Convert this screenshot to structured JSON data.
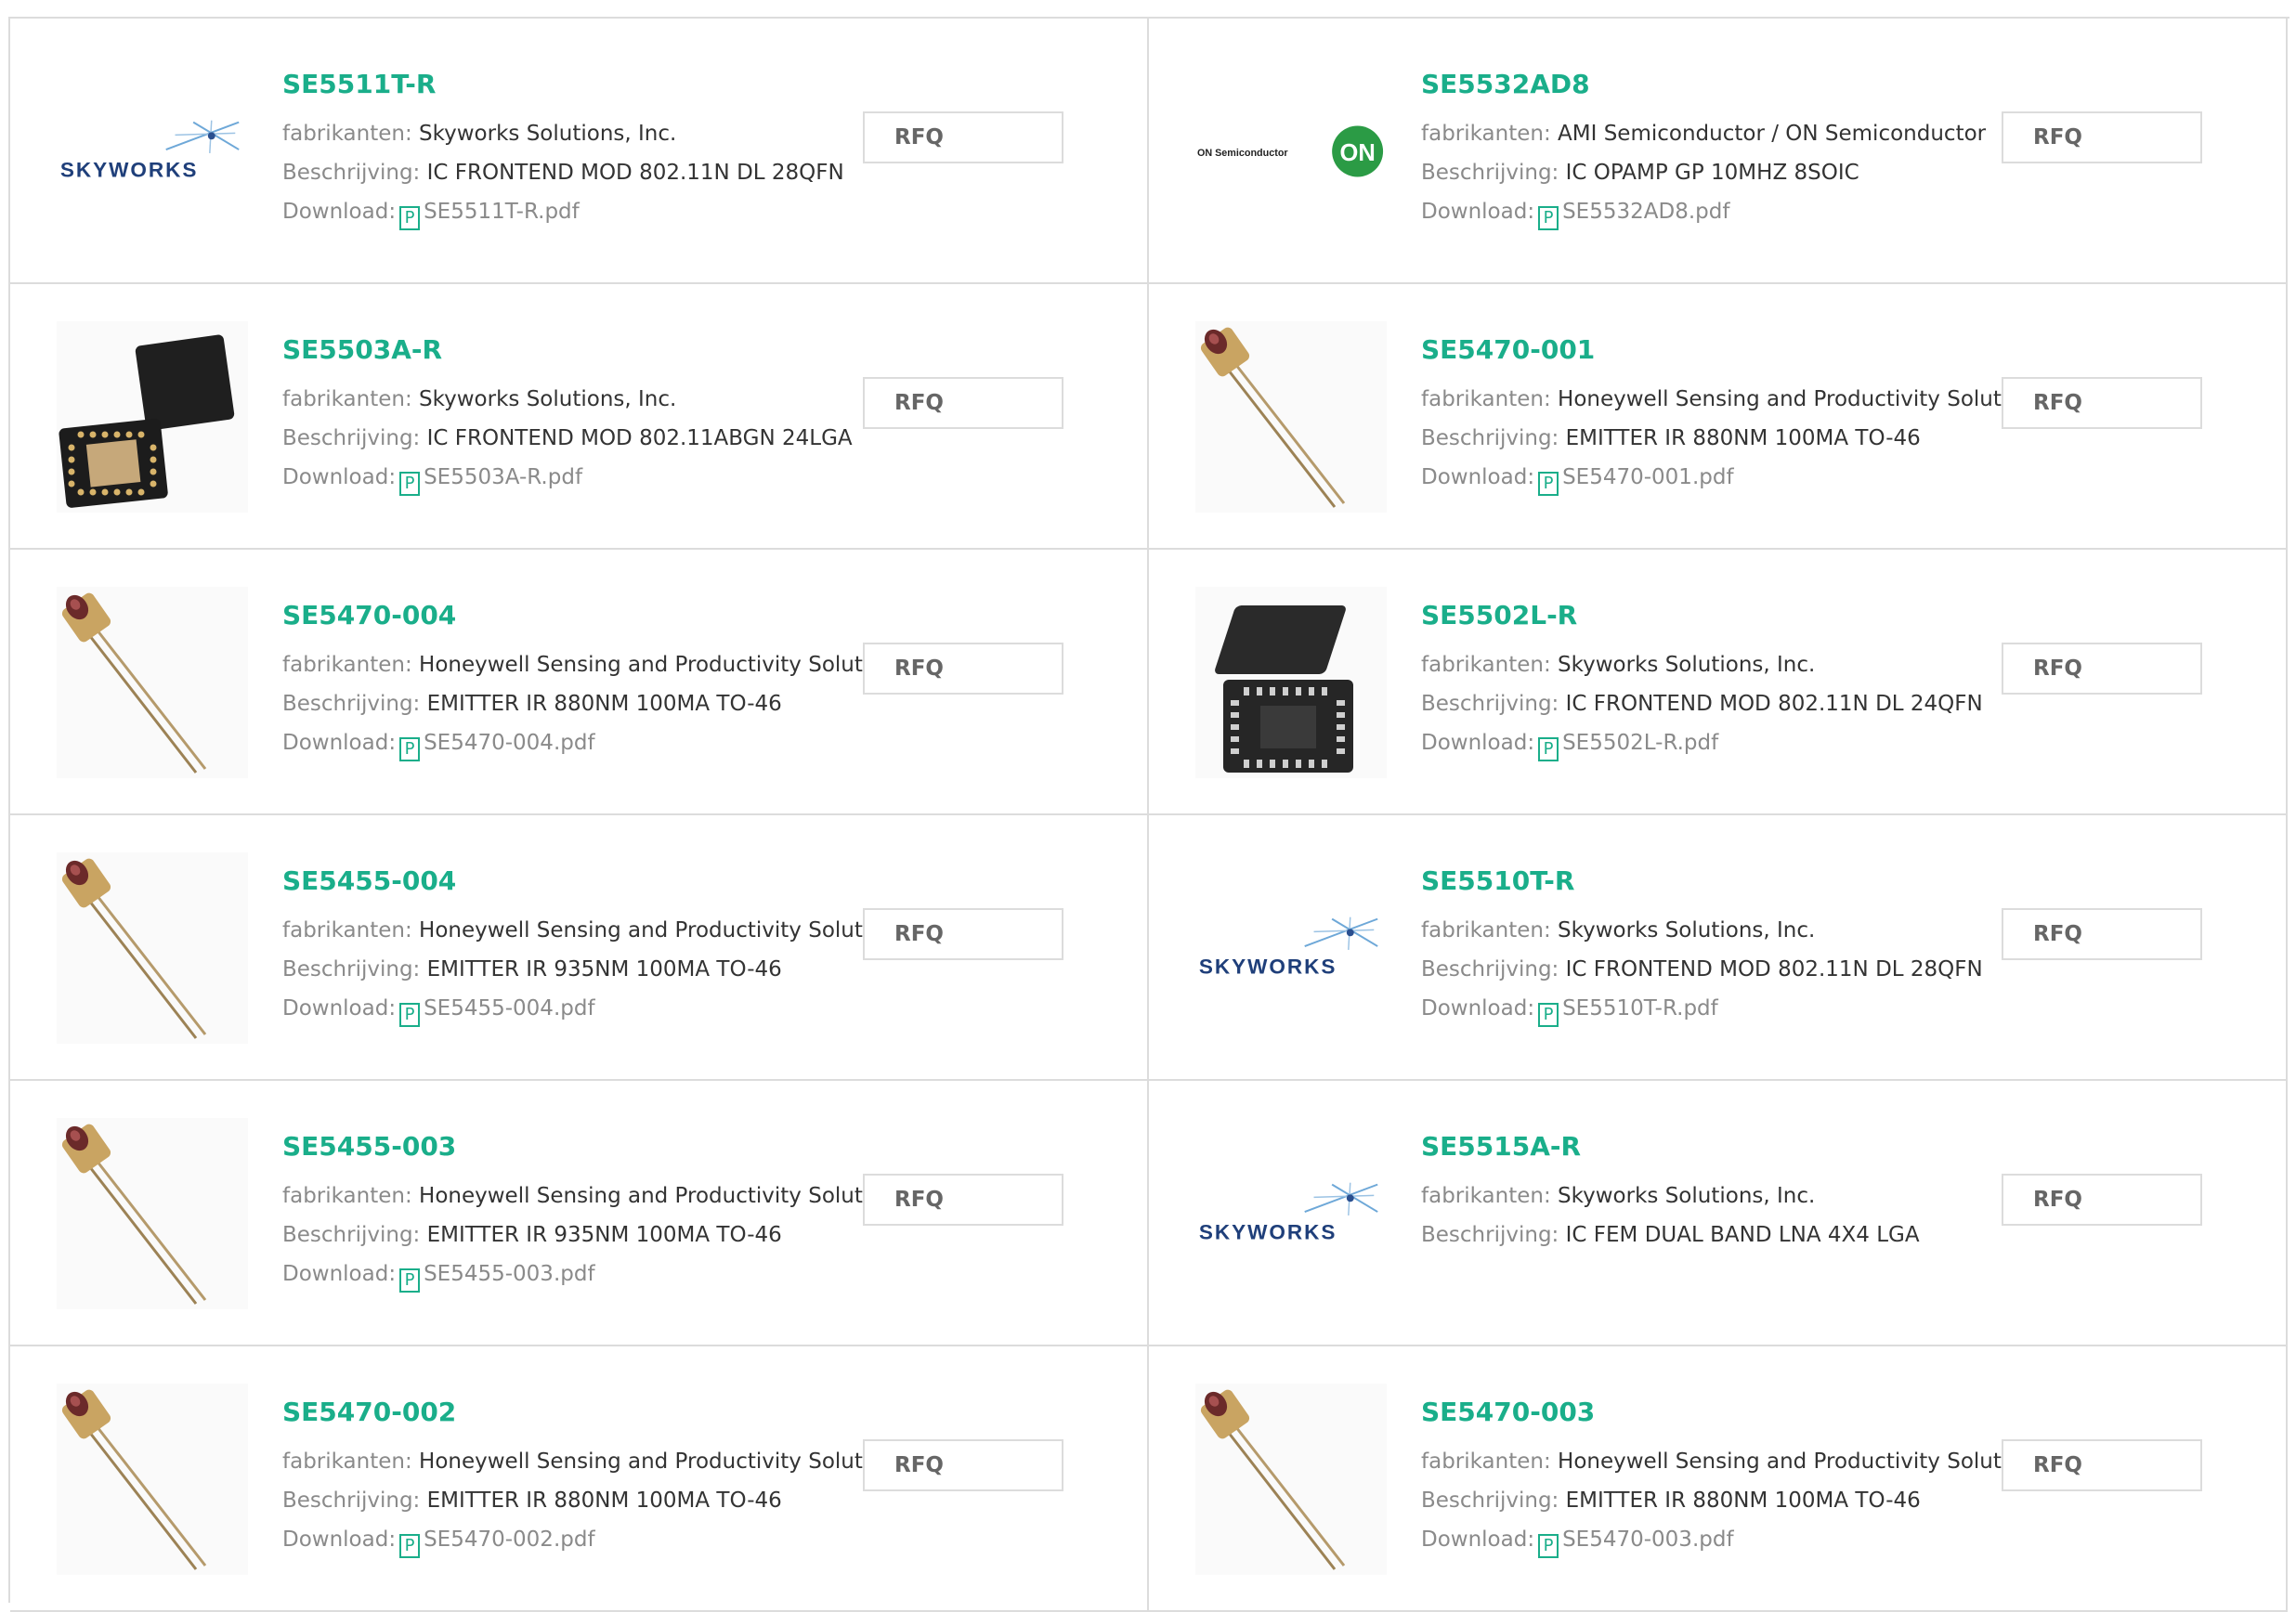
{
  "labels": {
    "manufacturer": "fabrikanten:",
    "description": "Beschrijving:",
    "download": "Download:",
    "rfq": "RFQ",
    "pdf_glyph": "P"
  },
  "colors": {
    "accent": "#1aae8a",
    "label_gray": "#8a8a8a",
    "border": "#dcdcdc"
  },
  "logos": {
    "skyworks": "SKYWORKS",
    "on_semi": "ON Semiconductor",
    "on_badge": "ON"
  },
  "products": [
    {
      "part": "SE5511T-R",
      "manufacturer": "Skyworks Solutions, Inc.",
      "description": "IC FRONTEND MOD 802.11N DL 28QFN",
      "download": "SE5511T-R.pdf",
      "image": "skyworks-logo"
    },
    {
      "part": "SE5532AD8",
      "manufacturer": "AMI Semiconductor / ON Semiconductor",
      "description": "IC OPAMP GP 10MHZ 8SOIC",
      "download": "SE5532AD8.pdf",
      "image": "on-semiconductor-logo"
    },
    {
      "part": "SE5503A-R",
      "manufacturer": "Skyworks Solutions, Inc.",
      "description": "IC FRONTEND MOD 802.11ABGN 24LGA",
      "download": "SE5503A-R.pdf",
      "image": "lga-chip"
    },
    {
      "part": "SE5470-001",
      "manufacturer": "Honeywell Sensing and Productivity Solutions",
      "description": "EMITTER IR 880NM 100MA TO-46",
      "download": "SE5470-001.pdf",
      "image": "to46-emitter"
    },
    {
      "part": "SE5470-004",
      "manufacturer": "Honeywell Sensing and Productivity Solutions",
      "description": "EMITTER IR 880NM 100MA TO-46",
      "download": "SE5470-004.pdf",
      "image": "to46-emitter"
    },
    {
      "part": "SE5502L-R",
      "manufacturer": "Skyworks Solutions, Inc.",
      "description": "IC FRONTEND MOD 802.11N DL 24QFN",
      "download": "SE5502L-R.pdf",
      "image": "qfn-chip"
    },
    {
      "part": "SE5455-004",
      "manufacturer": "Honeywell Sensing and Productivity Solutions",
      "description": "EMITTER IR 935NM 100MA TO-46",
      "download": "SE5455-004.pdf",
      "image": "to46-emitter"
    },
    {
      "part": "SE5510T-R",
      "manufacturer": "Skyworks Solutions, Inc.",
      "description": "IC FRONTEND MOD 802.11N DL 28QFN",
      "download": "SE5510T-R.pdf",
      "image": "skyworks-logo"
    },
    {
      "part": "SE5455-003",
      "manufacturer": "Honeywell Sensing and Productivity Solutions",
      "description": "EMITTER IR 935NM 100MA TO-46",
      "download": "SE5455-003.pdf",
      "image": "to46-emitter"
    },
    {
      "part": "SE5515A-R",
      "manufacturer": "Skyworks Solutions, Inc.",
      "description": "IC FEM DUAL BAND LNA 4X4 LGA",
      "download": null,
      "image": "skyworks-logo"
    },
    {
      "part": "SE5470-002",
      "manufacturer": "Honeywell Sensing and Productivity Solutions",
      "description": "EMITTER IR 880NM 100MA TO-46",
      "download": "SE5470-002.pdf",
      "image": "to46-emitter"
    },
    {
      "part": "SE5470-003",
      "manufacturer": "Honeywell Sensing and Productivity Solutions",
      "description": "EMITTER IR 880NM 100MA TO-46",
      "download": "SE5470-003.pdf",
      "image": "to46-emitter"
    }
  ]
}
